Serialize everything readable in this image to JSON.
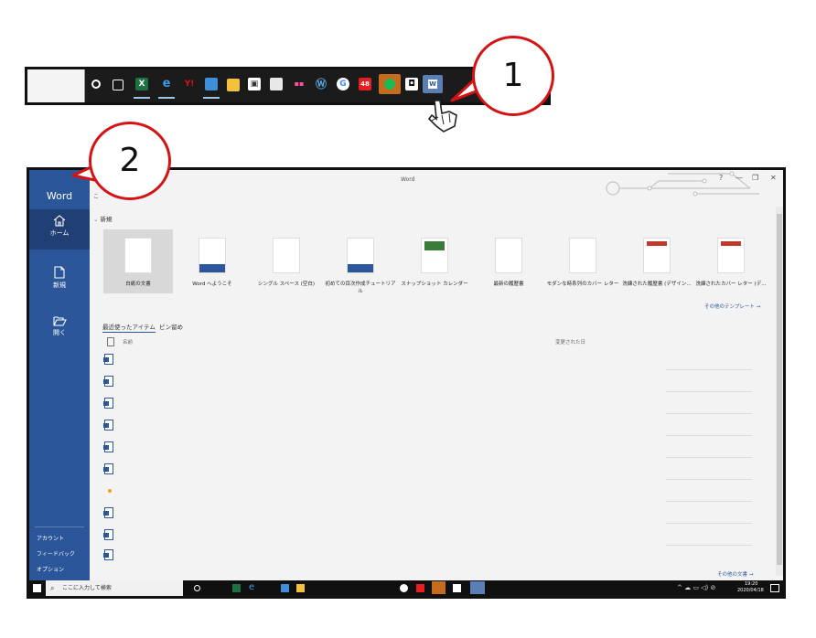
{
  "callouts": {
    "step1": "1",
    "step2": "2"
  },
  "window": {
    "title": "Word",
    "app_name": "Word",
    "partial_greeting": "こ"
  },
  "sidebar": {
    "home": "ホーム",
    "new": "新規",
    "open": "開く",
    "account": "アカウント",
    "feedback": "フィードバック",
    "options": "オプション"
  },
  "new_section": {
    "heading": "新規",
    "templates": [
      {
        "label": "白紙の文書"
      },
      {
        "label": "Word へようこそ"
      },
      {
        "label": "シングル スペース (空白)"
      },
      {
        "label": "初めての目次作成チュートリアル"
      },
      {
        "label": "スナップショット カレンダー"
      },
      {
        "label": "最新の履歴書"
      },
      {
        "label": "モダンな時系列のカバー レター"
      },
      {
        "label": "洗練された履歴書 (デザイン..."
      },
      {
        "label": "洗練されたカバー レター (デ..."
      }
    ],
    "more_templates": "その他のテンプレート →"
  },
  "recent": {
    "tab_recent": "最近使ったアイテム",
    "tab_pinned": "ピン留め",
    "col_name": "名前",
    "col_modified": "変更された日",
    "more_docs": "その他の文書 →"
  },
  "taskbar": {
    "search_placeholder": "ここに入力して検索",
    "time": "19:20",
    "date": "2020/04/18"
  },
  "colors": {
    "word_blue": "#2b579a",
    "callout_red": "#d41414"
  }
}
